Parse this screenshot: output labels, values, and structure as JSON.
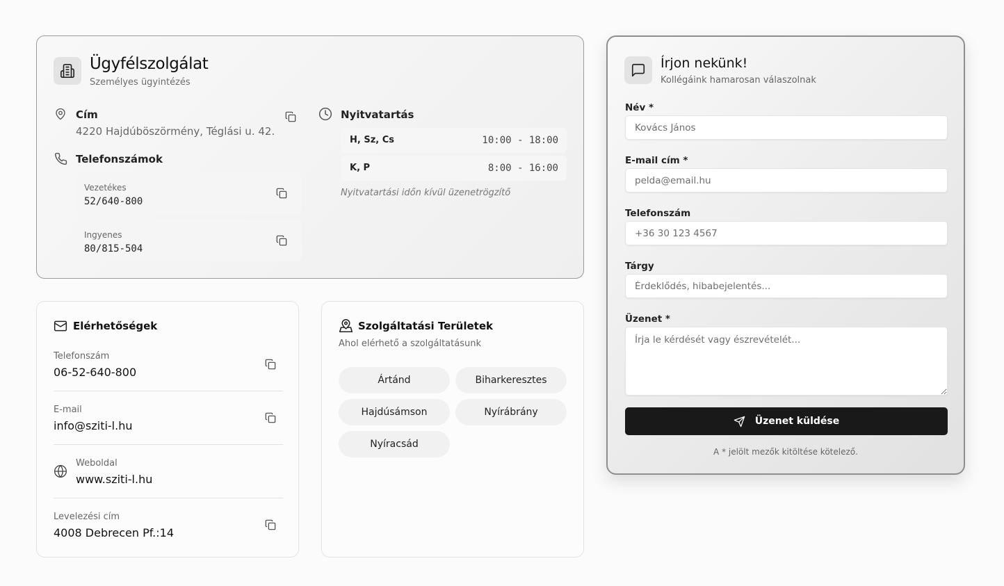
{
  "service": {
    "title": "Ügyfélszolgálat",
    "subtitle": "Személyes ügyintézés",
    "address_label": "Cím",
    "address_value": "4220 Hajdúböszörmény, Téglási u. 42.",
    "phones_label": "Telefonszámok",
    "phones": [
      {
        "type": "Vezetékes",
        "number": "52/640-800"
      },
      {
        "type": "Ingyenes",
        "number": "80/815-504"
      }
    ],
    "hours_label": "Nyitvatartás",
    "hours": [
      {
        "days": "H, Sz, Cs",
        "time": "10:00 - 18:00"
      },
      {
        "days": "K, P",
        "time": "8:00 - 16:00"
      }
    ],
    "hours_note": "Nyitvatartási időn kívül üzenetrögzítő"
  },
  "contacts": {
    "title": "Elérhetőségek",
    "items": [
      {
        "label": "Telefonszám",
        "value": "06-52-640-800"
      },
      {
        "label": "E-mail",
        "value": "info@sziti-l.hu"
      },
      {
        "label": "Weboldal",
        "value": "www.sziti-l.hu"
      },
      {
        "label": "Levelezési cím",
        "value": "4008 Debrecen Pf.:14"
      }
    ]
  },
  "areas": {
    "title": "Szolgáltatási Területek",
    "subtitle": "Ahol elérhető a szolgáltatásunk",
    "items": [
      "Ártánd",
      "Biharkeresztes",
      "Hajdúsámson",
      "Nyírábrány",
      "Nyíracsád"
    ]
  },
  "form": {
    "title": "Írjon nekünk!",
    "subtitle": "Kollégáink hamarosan válaszolnak",
    "name_label": "Név *",
    "name_placeholder": "Kovács János",
    "email_label": "E-mail cím *",
    "email_placeholder": "pelda@email.hu",
    "phone_label": "Telefonszám",
    "phone_placeholder": "+36 30 123 4567",
    "subject_label": "Tárgy",
    "subject_placeholder": "Érdeklődés, hibabejelentés...",
    "message_label": "Üzenet *",
    "message_placeholder": "Írja le kérdését vagy észrevételét...",
    "submit_label": "Üzenet küldése",
    "footnote": "A * jelölt mezők kitöltése kötelező."
  },
  "icons": {
    "building": "building-icon",
    "pin": "map-pin-icon",
    "phone": "phone-icon",
    "clock": "clock-icon",
    "copy": "copy-icon",
    "mail": "mail-icon",
    "globe": "globe-icon",
    "area": "map-area-icon",
    "chat": "message-square-icon",
    "send": "send-icon"
  }
}
